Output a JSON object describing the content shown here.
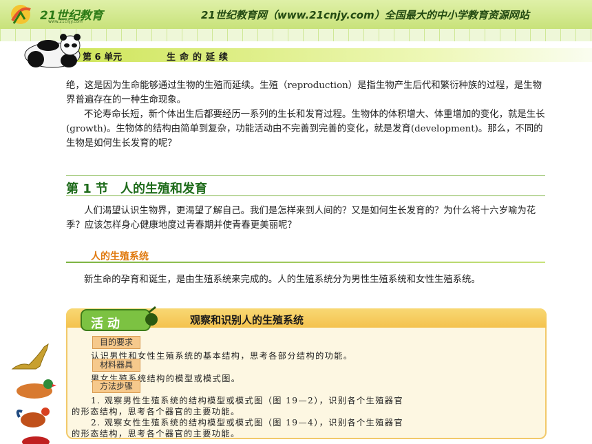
{
  "header": {
    "logo_main": "21世纪教育",
    "logo_sub": "www.21cnjy.com",
    "site_line": "21世纪教育网（www.21cnjy.com）全国最大的中小学教育资源网站"
  },
  "chapter": {
    "label": "第 6 单元",
    "title": "生命的延续"
  },
  "intro": {
    "p1": "绝，这是因为生命能够通过生物的生殖而延续。生殖（reproduction）是指生物产生后代和繁衍种族的过程，是生物界普遍存在的一种生命现象。",
    "p2": "不论寿命长短，新个体出生后都要经历一系列的生长和发育过程。生物体的体积增大、体重增加的变化，就是生长(growth)。生物体的结构由简单到复杂，功能活动由不完善到完善的变化，就是发育(development)。那么，不同的生物是如何生长发育的呢？"
  },
  "section": {
    "title": "第 1 节　人的生殖和发育",
    "p3": "人们渴望认识生物界，更渴望了解自己。我们是怎样来到人间的？又是如何生长发育的？为什么将十六岁喻为花季？应该怎样身心健康地度过青春期并使青春更美丽呢？"
  },
  "subsection": {
    "title": "人的生殖系统",
    "p4": "新生命的孕育和诞生，是由生殖系统来完成的。人的生殖系统分为男性生殖系统和女性生殖系统。"
  },
  "activity": {
    "badge": "活动",
    "title": "观察和识别人的生殖系统",
    "tag_goal": "目的要求",
    "goal": "认识男性和女性生殖系统的基本结构，思考各部分结构的功能。",
    "tag_materials": "材料器具",
    "materials": "男女生殖系统结构的模型或模式图。",
    "tag_steps": "方法步骤",
    "step1_a": "1. 观察男性生殖系统的结构模型或模式图（图 19—2），识别各个生殖器官",
    "step1_b": "的形态结构，思考各个器官的主要功能。",
    "step2_a": "2. 观察女性生殖系统的结构模型或模式图（图 19—4），识别各个生殖器官",
    "step2_b": "的形态结构，思考各个器官的主要功能。"
  }
}
